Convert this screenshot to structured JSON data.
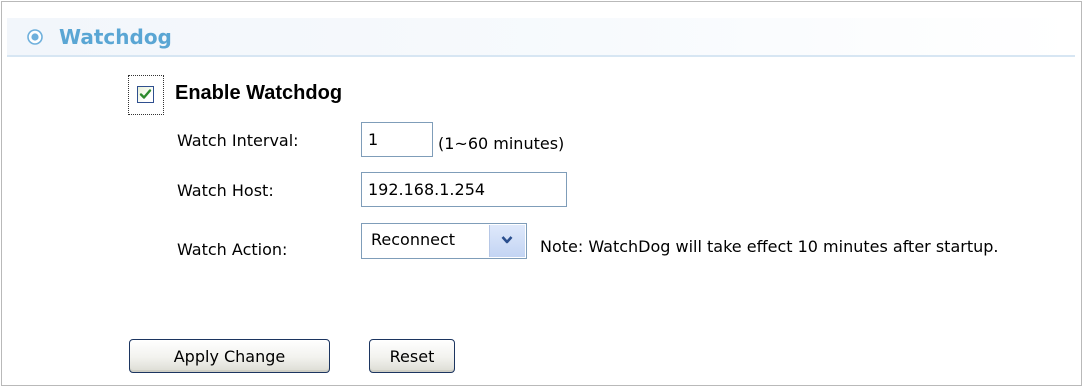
{
  "section": {
    "title": "Watchdog",
    "icon": "radio-target-icon",
    "title_color": "#5aa6d4"
  },
  "enable": {
    "label": "Enable Watchdog",
    "checked": true
  },
  "fields": {
    "interval_label": "Watch Interval:",
    "interval_value": "1",
    "interval_hint": "(1~60 minutes)",
    "host_label": "Watch Host:",
    "host_value": "192.168.1.254",
    "action_label": "Watch Action:",
    "action_value": "Reconnect",
    "action_note": "Note: WatchDog will take effect 10 minutes after startup."
  },
  "buttons": {
    "apply_label": "Apply Change",
    "reset_label": "Reset"
  }
}
